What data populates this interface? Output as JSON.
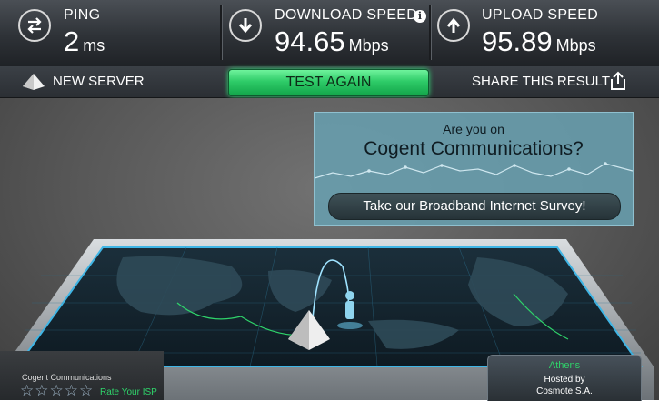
{
  "stats": {
    "ping": {
      "label": "PING",
      "value": "2",
      "unit": "ms",
      "icon": "ping-arrows-icon"
    },
    "download": {
      "label": "DOWNLOAD SPEED",
      "value": "94.65",
      "unit": "Mbps",
      "icon": "download-arrow-icon",
      "info_icon": "info-icon"
    },
    "upload": {
      "label": "UPLOAD SPEED",
      "value": "95.89",
      "unit": "Mbps",
      "icon": "upload-arrow-icon"
    }
  },
  "actions": {
    "new_server": "NEW SERVER",
    "test_again": "TEST AGAIN",
    "share": "SHARE THIS RESULT"
  },
  "survey": {
    "line1": "Are you on",
    "line2": "Cogent Communications?",
    "button": "Take our Broadband Internet Survey!"
  },
  "isp": {
    "name": "Cogent Communications",
    "rating_stars": 5,
    "rate_label": "Rate Your ISP"
  },
  "server": {
    "city": "Athens",
    "hosted_by_label": "Hosted by",
    "host": "Cosmote S.A."
  },
  "colors": {
    "accent_green": "#2ecb68",
    "survey_panel": "#689eae",
    "map_glow": "#3fb6e6",
    "route_line": "#2fd36a"
  }
}
